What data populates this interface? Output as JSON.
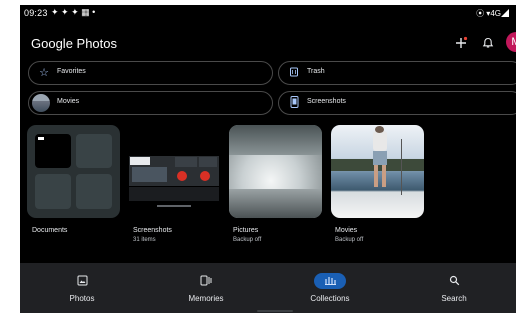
{
  "status": {
    "time": "09:23",
    "icons": "✦ ✦ ✦ ▦ •",
    "right": "⦿ ▾4G◢"
  },
  "app": {
    "title": "Google Photos",
    "avatar_letter": "M"
  },
  "chips": [
    {
      "label": "Favorites",
      "icon": "star-icon"
    },
    {
      "label": "Trash",
      "icon": "trash-icon"
    },
    {
      "label": "Movies",
      "icon": "movie-thumb"
    },
    {
      "label": "Screenshots",
      "icon": "phone-icon"
    }
  ],
  "albums": [
    {
      "title": "Documents",
      "subtitle": ""
    },
    {
      "title": "Screenshots",
      "subtitle": "31 items"
    },
    {
      "title": "Pictures",
      "subtitle": "Backup off"
    },
    {
      "title": "Movies",
      "subtitle": "Backup off"
    }
  ],
  "nav": [
    {
      "label": "Photos",
      "icon": "photo-icon",
      "active": false
    },
    {
      "label": "Memories",
      "icon": "memories-icon",
      "active": false
    },
    {
      "label": "Collections",
      "icon": "collections-icon",
      "active": true
    },
    {
      "label": "Search",
      "icon": "search-icon",
      "active": false
    }
  ],
  "colors": {
    "accent": "#1a5fb4",
    "avatar": "#c2185b",
    "background": "#000000"
  }
}
